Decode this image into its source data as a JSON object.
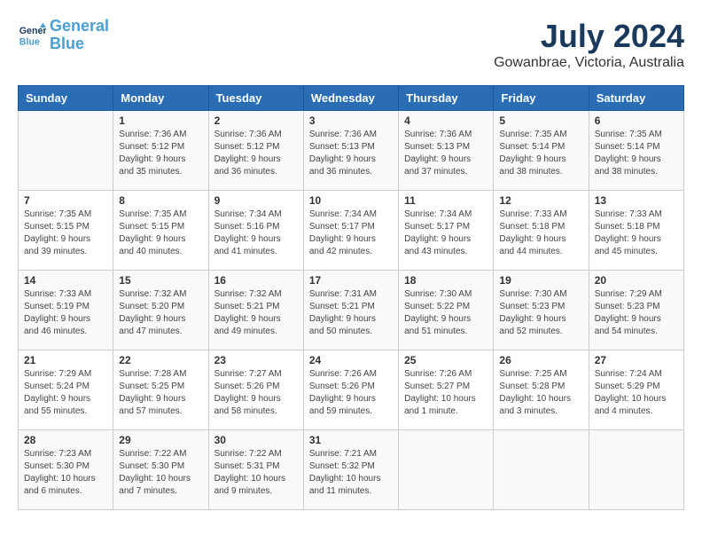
{
  "header": {
    "logo_line1": "General",
    "logo_line2": "Blue",
    "month": "July 2024",
    "location": "Gowanbrae, Victoria, Australia"
  },
  "weekdays": [
    "Sunday",
    "Monday",
    "Tuesday",
    "Wednesday",
    "Thursday",
    "Friday",
    "Saturday"
  ],
  "weeks": [
    [
      {
        "day": "",
        "info": ""
      },
      {
        "day": "1",
        "info": "Sunrise: 7:36 AM\nSunset: 5:12 PM\nDaylight: 9 hours\nand 35 minutes."
      },
      {
        "day": "2",
        "info": "Sunrise: 7:36 AM\nSunset: 5:12 PM\nDaylight: 9 hours\nand 36 minutes."
      },
      {
        "day": "3",
        "info": "Sunrise: 7:36 AM\nSunset: 5:13 PM\nDaylight: 9 hours\nand 36 minutes."
      },
      {
        "day": "4",
        "info": "Sunrise: 7:36 AM\nSunset: 5:13 PM\nDaylight: 9 hours\nand 37 minutes."
      },
      {
        "day": "5",
        "info": "Sunrise: 7:35 AM\nSunset: 5:14 PM\nDaylight: 9 hours\nand 38 minutes."
      },
      {
        "day": "6",
        "info": "Sunrise: 7:35 AM\nSunset: 5:14 PM\nDaylight: 9 hours\nand 38 minutes."
      }
    ],
    [
      {
        "day": "7",
        "info": "Sunrise: 7:35 AM\nSunset: 5:15 PM\nDaylight: 9 hours\nand 39 minutes."
      },
      {
        "day": "8",
        "info": "Sunrise: 7:35 AM\nSunset: 5:15 PM\nDaylight: 9 hours\nand 40 minutes."
      },
      {
        "day": "9",
        "info": "Sunrise: 7:34 AM\nSunset: 5:16 PM\nDaylight: 9 hours\nand 41 minutes."
      },
      {
        "day": "10",
        "info": "Sunrise: 7:34 AM\nSunset: 5:17 PM\nDaylight: 9 hours\nand 42 minutes."
      },
      {
        "day": "11",
        "info": "Sunrise: 7:34 AM\nSunset: 5:17 PM\nDaylight: 9 hours\nand 43 minutes."
      },
      {
        "day": "12",
        "info": "Sunrise: 7:33 AM\nSunset: 5:18 PM\nDaylight: 9 hours\nand 44 minutes."
      },
      {
        "day": "13",
        "info": "Sunrise: 7:33 AM\nSunset: 5:18 PM\nDaylight: 9 hours\nand 45 minutes."
      }
    ],
    [
      {
        "day": "14",
        "info": "Sunrise: 7:33 AM\nSunset: 5:19 PM\nDaylight: 9 hours\nand 46 minutes."
      },
      {
        "day": "15",
        "info": "Sunrise: 7:32 AM\nSunset: 5:20 PM\nDaylight: 9 hours\nand 47 minutes."
      },
      {
        "day": "16",
        "info": "Sunrise: 7:32 AM\nSunset: 5:21 PM\nDaylight: 9 hours\nand 49 minutes."
      },
      {
        "day": "17",
        "info": "Sunrise: 7:31 AM\nSunset: 5:21 PM\nDaylight: 9 hours\nand 50 minutes."
      },
      {
        "day": "18",
        "info": "Sunrise: 7:30 AM\nSunset: 5:22 PM\nDaylight: 9 hours\nand 51 minutes."
      },
      {
        "day": "19",
        "info": "Sunrise: 7:30 AM\nSunset: 5:23 PM\nDaylight: 9 hours\nand 52 minutes."
      },
      {
        "day": "20",
        "info": "Sunrise: 7:29 AM\nSunset: 5:23 PM\nDaylight: 9 hours\nand 54 minutes."
      }
    ],
    [
      {
        "day": "21",
        "info": "Sunrise: 7:29 AM\nSunset: 5:24 PM\nDaylight: 9 hours\nand 55 minutes."
      },
      {
        "day": "22",
        "info": "Sunrise: 7:28 AM\nSunset: 5:25 PM\nDaylight: 9 hours\nand 57 minutes."
      },
      {
        "day": "23",
        "info": "Sunrise: 7:27 AM\nSunset: 5:26 PM\nDaylight: 9 hours\nand 58 minutes."
      },
      {
        "day": "24",
        "info": "Sunrise: 7:26 AM\nSunset: 5:26 PM\nDaylight: 9 hours\nand 59 minutes."
      },
      {
        "day": "25",
        "info": "Sunrise: 7:26 AM\nSunset: 5:27 PM\nDaylight: 10 hours\nand 1 minute."
      },
      {
        "day": "26",
        "info": "Sunrise: 7:25 AM\nSunset: 5:28 PM\nDaylight: 10 hours\nand 3 minutes."
      },
      {
        "day": "27",
        "info": "Sunrise: 7:24 AM\nSunset: 5:29 PM\nDaylight: 10 hours\nand 4 minutes."
      }
    ],
    [
      {
        "day": "28",
        "info": "Sunrise: 7:23 AM\nSunset: 5:30 PM\nDaylight: 10 hours\nand 6 minutes."
      },
      {
        "day": "29",
        "info": "Sunrise: 7:22 AM\nSunset: 5:30 PM\nDaylight: 10 hours\nand 7 minutes."
      },
      {
        "day": "30",
        "info": "Sunrise: 7:22 AM\nSunset: 5:31 PM\nDaylight: 10 hours\nand 9 minutes."
      },
      {
        "day": "31",
        "info": "Sunrise: 7:21 AM\nSunset: 5:32 PM\nDaylight: 10 hours\nand 11 minutes."
      },
      {
        "day": "",
        "info": ""
      },
      {
        "day": "",
        "info": ""
      },
      {
        "day": "",
        "info": ""
      }
    ]
  ]
}
